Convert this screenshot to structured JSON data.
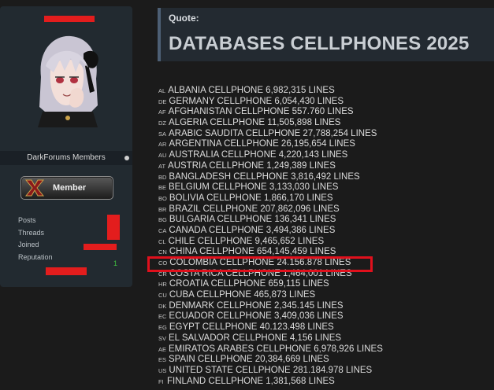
{
  "user_panel": {
    "group_name": "DarkForums Members",
    "badge_label": "Member",
    "stats": {
      "posts_label": "Posts",
      "threads_label": "Threads",
      "joined_label": "Joined",
      "reputation_label": "Reputation",
      "reputation_value": "1"
    }
  },
  "post": {
    "quote_label": "Quote:",
    "quote_title": "DATABASES CELLPHONES 2025",
    "countries": [
      {
        "code": "AL",
        "text": "ALBANIA CELLPHONE 6,982,315 LINES"
      },
      {
        "code": "DE",
        "text": "GERMANY CELLPHONE 6,054,430 LINES"
      },
      {
        "code": "AF",
        "text": "AFGHANISTAN CELLPHONE 557.760 LINES"
      },
      {
        "code": "DZ",
        "text": "ALGERIA CELLPHONE 11,505,898 LINES"
      },
      {
        "code": "SA",
        "text": "ARABIC SAUDITA CELLPHONE 27,788,254 LINES"
      },
      {
        "code": "AR",
        "text": "ARGENTINA CELLPHONE 26,195,654 LINES"
      },
      {
        "code": "AU",
        "text": "AUSTRALIA CELLPHONE 4,220,143 LINES"
      },
      {
        "code": "AT",
        "text": "AUSTRIA CELLPHONE 1,249,389 LINES"
      },
      {
        "code": "BD",
        "text": "BANGLADESH CELLPHONE 3,816,492 LINES"
      },
      {
        "code": "BE",
        "text": "BELGIUM CELLPHONE 3,133,030 LINES"
      },
      {
        "code": "BO",
        "text": "BOLIVIA CELLPHONE 1,866,170 LINES"
      },
      {
        "code": "BR",
        "text": "BRAZIL CELLPHONE 207,862,096 LINES"
      },
      {
        "code": "BG",
        "text": "BULGARIA CELLPHONE 136,341 LINES"
      },
      {
        "code": "CA",
        "text": "CANADA CELLPHONE 3,494,386 LINES"
      },
      {
        "code": "CL",
        "text": "CHILE CELLPHONE 9,465,652 LINES"
      },
      {
        "code": "CN",
        "text": "CHINA CELLPHONE 654,145,459 LINES"
      },
      {
        "code": "CO",
        "text": "COLOMBIA CELLPHONE 24.156.878 LINES"
      },
      {
        "code": "CR",
        "text": "COSTA RICA CELLPHONE 1,464,001 LINES"
      },
      {
        "code": "HR",
        "text": "CROATIA CELLPHONE 659,115 LINES"
      },
      {
        "code": "CU",
        "text": "CUBA CELLPHONE 465,873 LINES"
      },
      {
        "code": "DK",
        "text": "DENMARK CELLPHONE 2,345.145 LINES"
      },
      {
        "code": "EC",
        "text": "ECUADOR CELLPHONE 3,409,036 LINES"
      },
      {
        "code": "EG",
        "text": "EGYPT CELLPHONE 40.123.498 LINES"
      },
      {
        "code": "SV",
        "text": "EL SALVADOR CELLPHONE 4,156 LINES"
      },
      {
        "code": "AE",
        "text": "EMIRATOS ARABES CELLPHONE 6,978,926 LINES"
      },
      {
        "code": "ES",
        "text": "SPAIN CELLPHONE 20,384,669 LINES"
      },
      {
        "code": "US",
        "text": "UNITED STATE CELLPHONE 281.184.978 LINES"
      },
      {
        "code": "FI",
        "text": "FINLAND CELLPHONE 1,381,568 LINES"
      }
    ]
  },
  "colors": {
    "panel_bg": "#222a30",
    "page_bg": "#1b1b1b",
    "redaction": "#e31d1d",
    "highlight": "#e0101c",
    "reputation_positive": "#3fbf3f"
  }
}
